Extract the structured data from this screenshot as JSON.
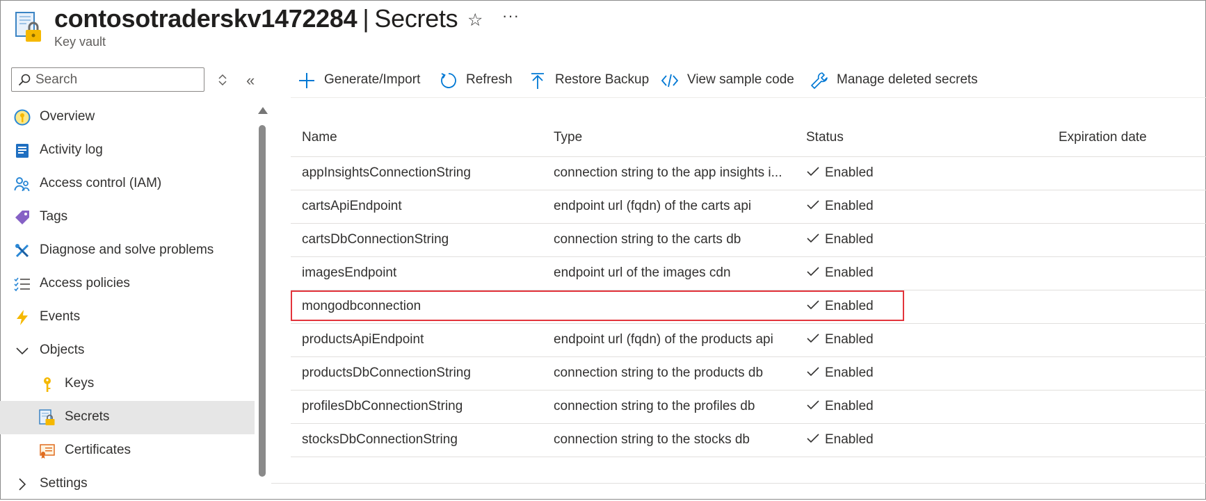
{
  "header": {
    "resource_name": "contosotraderskv1472284",
    "separator": "|",
    "section": "Secrets",
    "subtitle": "Key vault",
    "favorite_icon": "star-icon",
    "more_icon": "more-icon"
  },
  "sidebar": {
    "search": {
      "placeholder": "Search",
      "value": ""
    },
    "items": [
      {
        "label": "Overview",
        "icon": "overview-icon",
        "level": 0
      },
      {
        "label": "Activity log",
        "icon": "activity-log-icon",
        "level": 0
      },
      {
        "label": "Access control (IAM)",
        "icon": "access-control-icon",
        "level": 0
      },
      {
        "label": "Tags",
        "icon": "tag-icon",
        "level": 0
      },
      {
        "label": "Diagnose and solve problems",
        "icon": "wrench-icon",
        "level": 0
      },
      {
        "label": "Access policies",
        "icon": "list-check-icon",
        "level": 0
      },
      {
        "label": "Events",
        "icon": "lightning-icon",
        "level": 0
      },
      {
        "label": "Objects",
        "icon": "chevron-down-icon",
        "level": 0
      },
      {
        "label": "Keys",
        "icon": "key-icon",
        "level": 1
      },
      {
        "label": "Secrets",
        "icon": "secret-icon",
        "level": 1,
        "selected": true
      },
      {
        "label": "Certificates",
        "icon": "certificate-icon",
        "level": 1
      },
      {
        "label": "Settings",
        "icon": "chevron-right-icon",
        "level": 0
      }
    ]
  },
  "toolbar": {
    "generate_import": "Generate/Import",
    "refresh": "Refresh",
    "restore_backup": "Restore Backup",
    "view_sample_code": "View sample code",
    "manage_deleted_secrets": "Manage deleted secrets"
  },
  "table": {
    "columns": {
      "name": "Name",
      "type": "Type",
      "status": "Status",
      "expiration": "Expiration date"
    },
    "rows": [
      {
        "name": "appInsightsConnectionString",
        "type": "connection string to the app insights i...",
        "status": "Enabled",
        "expiration": ""
      },
      {
        "name": "cartsApiEndpoint",
        "type": "endpoint url (fqdn) of the carts api",
        "status": "Enabled",
        "expiration": ""
      },
      {
        "name": "cartsDbConnectionString",
        "type": "connection string to the carts db",
        "status": "Enabled",
        "expiration": ""
      },
      {
        "name": "imagesEndpoint",
        "type": "endpoint url of the images cdn",
        "status": "Enabled",
        "expiration": ""
      },
      {
        "name": "mongodbconnection",
        "type": "",
        "status": "Enabled",
        "expiration": "",
        "highlighted": true
      },
      {
        "name": "productsApiEndpoint",
        "type": "endpoint url (fqdn) of the products api",
        "status": "Enabled",
        "expiration": ""
      },
      {
        "name": "productsDbConnectionString",
        "type": "connection string to the products db",
        "status": "Enabled",
        "expiration": ""
      },
      {
        "name": "profilesDbConnectionString",
        "type": "connection string to the profiles db",
        "status": "Enabled",
        "expiration": ""
      },
      {
        "name": "stocksDbConnectionString",
        "type": "connection string to the stocks db",
        "status": "Enabled",
        "expiration": ""
      }
    ]
  },
  "colors": {
    "accent": "#0078d4",
    "highlight_border": "#e3343b",
    "selected_bg": "#e6e6e6",
    "text": "#323130"
  }
}
